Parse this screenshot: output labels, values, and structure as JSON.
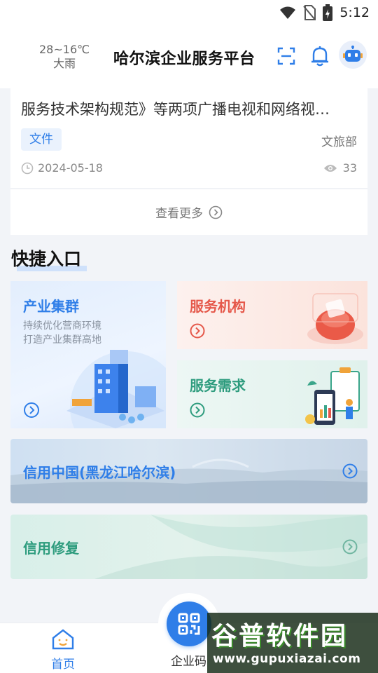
{
  "status": {
    "time": "5:12"
  },
  "header": {
    "weather_temp": "28~16℃",
    "weather_desc": "大雨",
    "title": "哈尔滨企业服务平台"
  },
  "news": {
    "title": "服务技术架构规范》等两项广播电视和网络视…",
    "tag": "文件",
    "source": "文旅部",
    "date": "2024-05-18",
    "views": "33",
    "more_label": "查看更多"
  },
  "quick_entry": {
    "title": "快捷入口",
    "tiles": [
      {
        "title": "产业集群",
        "subtitle_1": "持续优化营商环境",
        "subtitle_2": "打造产业集群高地",
        "color": "#2f7ee8"
      },
      {
        "title": "服务机构",
        "color": "#e5584a"
      },
      {
        "title": "服务需求",
        "color": "#2e9c7e"
      }
    ],
    "banners": [
      {
        "label": "信用中国(黑龙江哈尔滨)",
        "color": "#2f7ee8"
      },
      {
        "label": "信用修复",
        "color": "#2e9c7e"
      }
    ]
  },
  "bottom_nav": {
    "home_label": "首页",
    "qr_label": "企业码"
  },
  "watermark": {
    "brand": "谷普软件园",
    "url": "www.gupuxiazai.com"
  },
  "colors": {
    "accent": "#2f7ee8",
    "red": "#e5584a",
    "green": "#2e9c7e"
  }
}
